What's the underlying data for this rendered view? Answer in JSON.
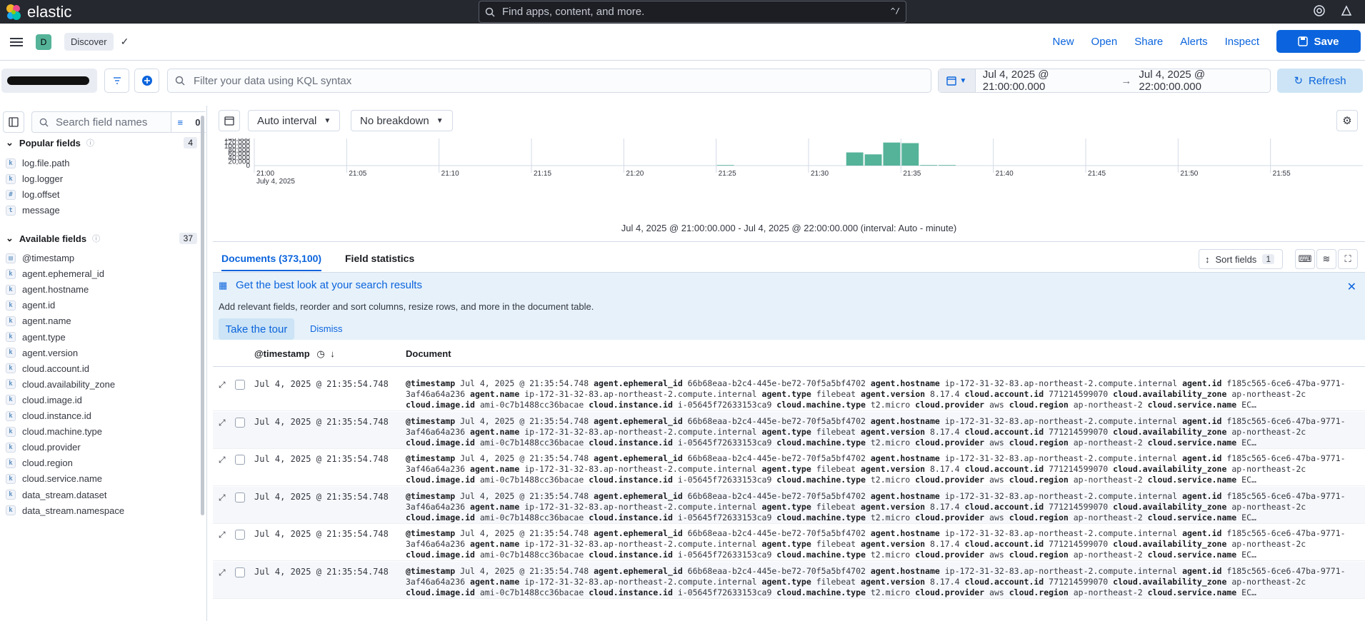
{
  "topbar": {
    "brand": "elastic",
    "search_placeholder": "Find apps, content, and more.",
    "shortcut": "^/"
  },
  "appbar": {
    "space_letter": "D",
    "breadcrumb": "Discover",
    "links": [
      "New",
      "Open",
      "Share",
      "Alerts",
      "Inspect"
    ],
    "save_label": "Save"
  },
  "query": {
    "kql_placeholder": "Filter your data using KQL syntax",
    "date_start": "Jul 4, 2025 @ 21:00:00.000",
    "date_arrow": "→",
    "date_end": "Jul 4, 2025 @ 22:00:00.000",
    "refresh_label": "Refresh"
  },
  "sidebar": {
    "search_placeholder": "Search field names",
    "filter_count": "0",
    "popular": {
      "title": "Popular fields",
      "count": "4",
      "fields": [
        {
          "type": "k",
          "name": "log.file.path"
        },
        {
          "type": "k",
          "name": "log.logger"
        },
        {
          "type": "#",
          "name": "log.offset"
        },
        {
          "type": "t",
          "name": "message"
        }
      ]
    },
    "available": {
      "title": "Available fields",
      "count": "37",
      "fields": [
        {
          "type": "date",
          "name": "@timestamp"
        },
        {
          "type": "k",
          "name": "agent.ephemeral_id"
        },
        {
          "type": "k",
          "name": "agent.hostname"
        },
        {
          "type": "k",
          "name": "agent.id"
        },
        {
          "type": "k",
          "name": "agent.name"
        },
        {
          "type": "k",
          "name": "agent.type"
        },
        {
          "type": "k",
          "name": "agent.version"
        },
        {
          "type": "k",
          "name": "cloud.account.id"
        },
        {
          "type": "k",
          "name": "cloud.availability_zone"
        },
        {
          "type": "k",
          "name": "cloud.image.id"
        },
        {
          "type": "k",
          "name": "cloud.instance.id"
        },
        {
          "type": "k",
          "name": "cloud.machine.type"
        },
        {
          "type": "k",
          "name": "cloud.provider"
        },
        {
          "type": "k",
          "name": "cloud.region"
        },
        {
          "type": "k",
          "name": "cloud.service.name"
        },
        {
          "type": "k",
          "name": "data_stream.dataset"
        },
        {
          "type": "k",
          "name": "data_stream.namespace"
        }
      ]
    }
  },
  "controls": {
    "interval_label": "Auto interval",
    "breakdown_label": "No breakdown"
  },
  "chart_data": {
    "type": "bar",
    "y_ticks": [
      "140,000",
      "120,000",
      "100,000",
      "80,000",
      "60,000",
      "40,000",
      "20,000",
      "0"
    ],
    "ylim": [
      0,
      140000
    ],
    "x_ticks": [
      "21:00",
      "21:05",
      "21:10",
      "21:15",
      "21:20",
      "21:25",
      "21:30",
      "21:35",
      "21:40",
      "21:45",
      "21:50",
      "21:55"
    ],
    "x_subtitle": "July 4, 2025",
    "bars": [
      {
        "minute": "21:25",
        "value": 3000
      },
      {
        "minute": "21:32",
        "value": 68000
      },
      {
        "minute": "21:33",
        "value": 58000
      },
      {
        "minute": "21:34",
        "value": 119000
      },
      {
        "minute": "21:35",
        "value": 116000
      },
      {
        "minute": "21:36",
        "value": 3000
      },
      {
        "minute": "21:37",
        "value": 3000
      }
    ],
    "color": "#54b399"
  },
  "interval_text": "Jul 4, 2025 @ 21:00:00.000 - Jul 4, 2025 @ 22:00:00.000 (interval: Auto - minute)",
  "tabs": {
    "documents": "Documents (373,100)",
    "stats": "Field statistics",
    "sort_label": "Sort fields",
    "sort_count": "1"
  },
  "callout": {
    "title": "Get the best look at your search results",
    "desc": "Add relevant fields, reorder and sort columns, resize rows, and more in the document table.",
    "tour": "Take the tour",
    "dismiss": "Dismiss"
  },
  "grid": {
    "col_timestamp": "@timestamp",
    "col_document": "Document",
    "rows": [
      {
        "ts": "Jul 4, 2025 @ 21:35:54.748"
      },
      {
        "ts": "Jul 4, 2025 @ 21:35:54.748"
      },
      {
        "ts": "Jul 4, 2025 @ 21:35:54.748"
      },
      {
        "ts": "Jul 4, 2025 @ 21:35:54.748"
      },
      {
        "ts": "Jul 4, 2025 @ 21:35:54.748"
      },
      {
        "ts": "Jul 4, 2025 @ 21:35:54.748"
      }
    ],
    "doc_pairs": [
      [
        "@timestamp",
        "Jul 4, 2025 @ 21:35:54.748"
      ],
      [
        "agent.ephemeral_id",
        "66b68eaa-b2c4-445e-be72-70f5a5bf4702"
      ],
      [
        "agent.hostname",
        "ip-172-31-32-83.ap-northeast-2.compute.internal"
      ],
      [
        "agent.id",
        "f185c565-6ce6-47ba-9771-3af46a64a236"
      ],
      [
        "agent.name",
        "ip-172-31-32-83.ap-northeast-2.compute.internal"
      ],
      [
        "agent.type",
        "filebeat"
      ],
      [
        "agent.version",
        "8.17.4"
      ],
      [
        "cloud.account.id",
        "771214599070"
      ],
      [
        "cloud.availability_zone",
        "ap-northeast-2c"
      ],
      [
        "cloud.image.id",
        "ami-0c7b1488cc36bacae"
      ],
      [
        "cloud.instance.id",
        "i-05645f72633153ca9"
      ],
      [
        "cloud.machine.type",
        "t2.micro"
      ],
      [
        "cloud.provider",
        "aws"
      ],
      [
        "cloud.region",
        "ap-northeast-2"
      ],
      [
        "cloud.service.name",
        "EC…"
      ]
    ]
  }
}
